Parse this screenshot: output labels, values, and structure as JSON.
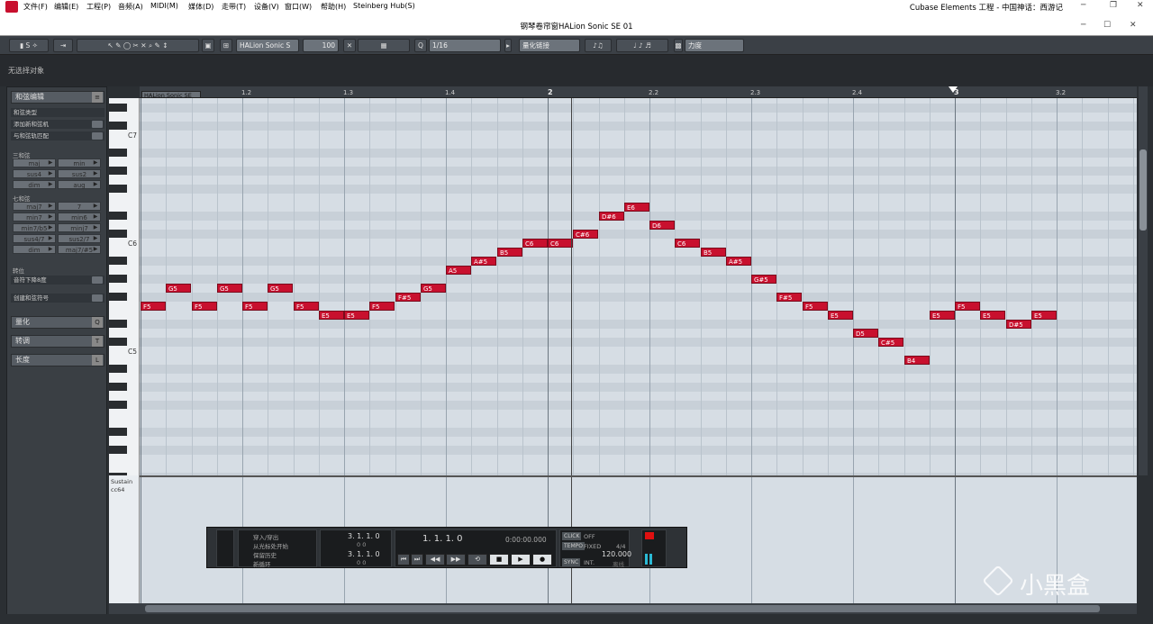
{
  "menubar": {
    "items": [
      "文件(F)",
      "编辑(E)",
      "工程(P)",
      "音频(A)",
      "MIDI(M)",
      "媒体(D)",
      "走带(T)",
      "设备(V)",
      "窗口(W)",
      "帮助(H)",
      "Steinberg Hub(S)"
    ],
    "app_title": "Cubase Elements 工程 - 中国神话：西游记"
  },
  "editor": {
    "window_title": "钢琴卷帘窗HALion Sonic SE 01",
    "info_line": "无选择对象"
  },
  "toolbar": {
    "instrument": "HALion Sonic S",
    "velocity": "100",
    "quantize": "1/16",
    "quantize_mode": "量化链接",
    "controller": "力度"
  },
  "chord_panel": {
    "title": "和弦编辑",
    "rows": [
      "和弦类型",
      "添加新和弦机",
      "与和弦轨匹配"
    ],
    "triads_label": "三和弦",
    "triads": [
      "maj",
      "min",
      "sus4",
      "sus2",
      "dim",
      "aug"
    ],
    "sevenths_label": "七和弦",
    "sevenths": [
      "maj7",
      "7",
      "min7",
      "min6",
      "min7/b5",
      "minj7",
      "sus4/7",
      "sus2/7",
      "dim",
      "maj7/#5"
    ],
    "inversion_label": "转位",
    "drop_label": "音符下降8度",
    "create_label": "创建和弦符号",
    "sections": [
      {
        "label": "量化",
        "key": "Q"
      },
      {
        "label": "转调",
        "key": "T"
      },
      {
        "label": "长度",
        "key": "L"
      }
    ]
  },
  "ruler": {
    "ticks": [
      "1.2",
      "1.3",
      "1.4",
      "2",
      "2.2",
      "2.3",
      "2.4",
      "3",
      "3.2"
    ],
    "track_label": "HALion Sonic SE 01"
  },
  "keyboard": {
    "labels": [
      "C7",
      "C6",
      "C5"
    ]
  },
  "notes": [
    {
      "pitch": "F5",
      "start": 0,
      "len": 1
    },
    {
      "pitch": "G5",
      "start": 1,
      "len": 1
    },
    {
      "pitch": "F5",
      "start": 2,
      "len": 1
    },
    {
      "pitch": "G5",
      "start": 3,
      "len": 1
    },
    {
      "pitch": "F5",
      "start": 4,
      "len": 1
    },
    {
      "pitch": "G5",
      "start": 5,
      "len": 1
    },
    {
      "pitch": "F5",
      "start": 6,
      "len": 1
    },
    {
      "pitch": "E5",
      "start": 7,
      "len": 1
    },
    {
      "pitch": "E5",
      "start": 8,
      "len": 1
    },
    {
      "pitch": "F5",
      "start": 9,
      "len": 1
    },
    {
      "pitch": "F#5",
      "start": 10,
      "len": 1
    },
    {
      "pitch": "G5",
      "start": 11,
      "len": 1
    },
    {
      "pitch": "A5",
      "start": 12,
      "len": 1
    },
    {
      "pitch": "A#5",
      "start": 13,
      "len": 1
    },
    {
      "pitch": "B5",
      "start": 14,
      "len": 1
    },
    {
      "pitch": "C6",
      "start": 15,
      "len": 1
    },
    {
      "pitch": "C6",
      "start": 16,
      "len": 1
    },
    {
      "pitch": "C#6",
      "start": 17,
      "len": 1
    },
    {
      "pitch": "D#6",
      "start": 18,
      "len": 1
    },
    {
      "pitch": "E6",
      "start": 19,
      "len": 1
    },
    {
      "pitch": "D6",
      "start": 20,
      "len": 1
    },
    {
      "pitch": "C6",
      "start": 21,
      "len": 1
    },
    {
      "pitch": "B5",
      "start": 22,
      "len": 1
    },
    {
      "pitch": "A#5",
      "start": 23,
      "len": 1
    },
    {
      "pitch": "G#5",
      "start": 24,
      "len": 1
    },
    {
      "pitch": "F#5",
      "start": 25,
      "len": 1
    },
    {
      "pitch": "F5",
      "start": 26,
      "len": 1
    },
    {
      "pitch": "E5",
      "start": 27,
      "len": 1
    },
    {
      "pitch": "D5",
      "start": 28,
      "len": 1
    },
    {
      "pitch": "C#5",
      "start": 29,
      "len": 1
    },
    {
      "pitch": "B4",
      "start": 30,
      "len": 1
    },
    {
      "pitch": "E5",
      "start": 31,
      "len": 1
    },
    {
      "pitch": "F5",
      "start": 32,
      "len": 1
    },
    {
      "pitch": "E5",
      "start": 33,
      "len": 1
    },
    {
      "pitch": "D#5",
      "start": 34,
      "len": 1
    },
    {
      "pitch": "E5",
      "start": 35,
      "len": 1
    }
  ],
  "controller_lane": {
    "name": "Sustain",
    "cc": "cc64"
  },
  "transport": {
    "modes": [
      "穿入/穿出",
      "从光标处开始",
      "保留历史",
      "新循环"
    ],
    "left_locator": "3. 1. 1.   0",
    "left_sub": "0   0",
    "right_locator": "3. 1. 1.   0",
    "right_sub": "0   0",
    "position": "1. 1. 1.   0",
    "time": "0:00:00.000",
    "click_label": "CLICK",
    "click_value": "OFF",
    "tempo_label": "TEMPO",
    "tempo_mode": "FIXED",
    "signature": "4/4",
    "tempo": "120.000",
    "sync_label": "SYNC",
    "sync_value": "INT.",
    "sync_extra": "离线"
  },
  "watermark": {
    "text": "小黑盒"
  }
}
